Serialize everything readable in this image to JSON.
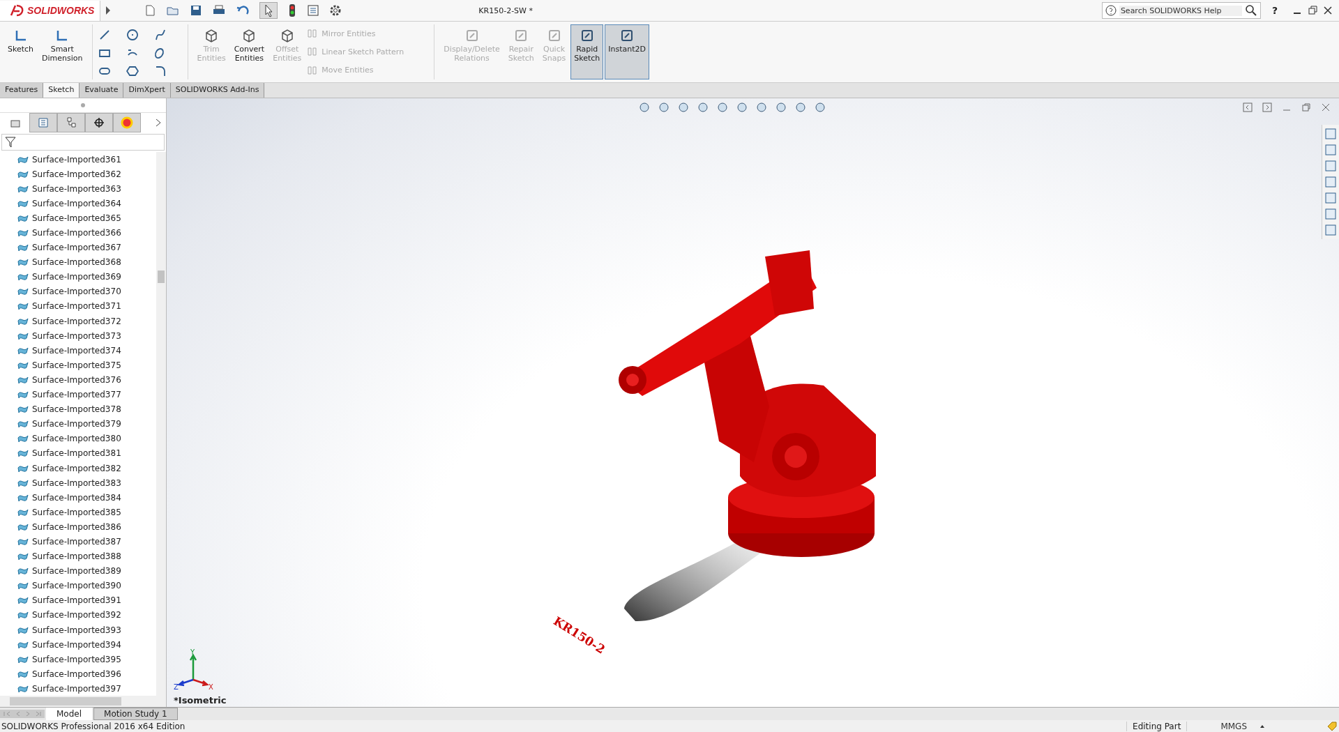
{
  "app": {
    "logo": "SOLIDWORKS",
    "title": "KR150-2-SW *",
    "search": {
      "placeholder": "Search SOLIDWORKS Help"
    },
    "help": "?"
  },
  "ribbon": {
    "big_left": [
      {
        "label": "Sketch",
        "disabled": false,
        "selected": false
      },
      {
        "label": "Smart Dimension",
        "disabled": false,
        "selected": false
      }
    ],
    "big_mid": [
      {
        "label": "Trim Entities",
        "disabled": true,
        "selected": false
      },
      {
        "label": "Convert Entities",
        "disabled": false,
        "selected": false
      },
      {
        "label": "Offset Entities",
        "disabled": true,
        "selected": false
      }
    ],
    "small": [
      {
        "label": "Mirror Entities",
        "disabled": true
      },
      {
        "label": "Linear Sketch Pattern",
        "disabled": true
      },
      {
        "label": "Move Entities",
        "disabled": true
      }
    ],
    "big_right": [
      {
        "label": "Display/Delete Relations",
        "disabled": true,
        "selected": false
      },
      {
        "label": "Repair Sketch",
        "disabled": true,
        "selected": false
      },
      {
        "label": "Quick Snaps",
        "disabled": true,
        "selected": false
      },
      {
        "label": "Rapid Sketch",
        "disabled": false,
        "selected": true
      },
      {
        "label": "Instant2D",
        "disabled": false,
        "selected": true
      }
    ]
  },
  "tabs": [
    {
      "label": "Features",
      "selected": false
    },
    {
      "label": "Sketch",
      "selected": true
    },
    {
      "label": "Evaluate",
      "selected": false
    },
    {
      "label": "DimXpert",
      "selected": false
    },
    {
      "label": "SOLIDWORKS Add-Ins",
      "selected": false
    }
  ],
  "panel_tabs": [
    {
      "selected": true
    },
    {
      "selected": false
    },
    {
      "selected": false
    },
    {
      "selected": false
    },
    {
      "selected": false
    }
  ],
  "feature_tree": {
    "items": [
      "Surface-Imported361",
      "Surface-Imported362",
      "Surface-Imported363",
      "Surface-Imported364",
      "Surface-Imported365",
      "Surface-Imported366",
      "Surface-Imported367",
      "Surface-Imported368",
      "Surface-Imported369",
      "Surface-Imported370",
      "Surface-Imported371",
      "Surface-Imported372",
      "Surface-Imported373",
      "Surface-Imported374",
      "Surface-Imported375",
      "Surface-Imported376",
      "Surface-Imported377",
      "Surface-Imported378",
      "Surface-Imported379",
      "Surface-Imported380",
      "Surface-Imported381",
      "Surface-Imported382",
      "Surface-Imported383",
      "Surface-Imported384",
      "Surface-Imported385",
      "Surface-Imported386",
      "Surface-Imported387",
      "Surface-Imported388",
      "Surface-Imported389",
      "Surface-Imported390",
      "Surface-Imported391",
      "Surface-Imported392",
      "Surface-Imported393",
      "Surface-Imported394",
      "Surface-Imported395",
      "Surface-Imported396",
      "Surface-Imported397"
    ]
  },
  "viewport": {
    "model_label": "KR150-2",
    "view_name": "*Isometric",
    "triad": [
      "Y",
      "Z",
      "X"
    ]
  },
  "bottom_tabs": [
    {
      "label": "Model",
      "selected": true
    },
    {
      "label": "Motion Study 1",
      "selected": false
    }
  ],
  "status_bar": {
    "edition": "SOLIDWORKS Professional 2016 x64 Edition",
    "mode": "Editing Part",
    "units": "MMGS"
  }
}
